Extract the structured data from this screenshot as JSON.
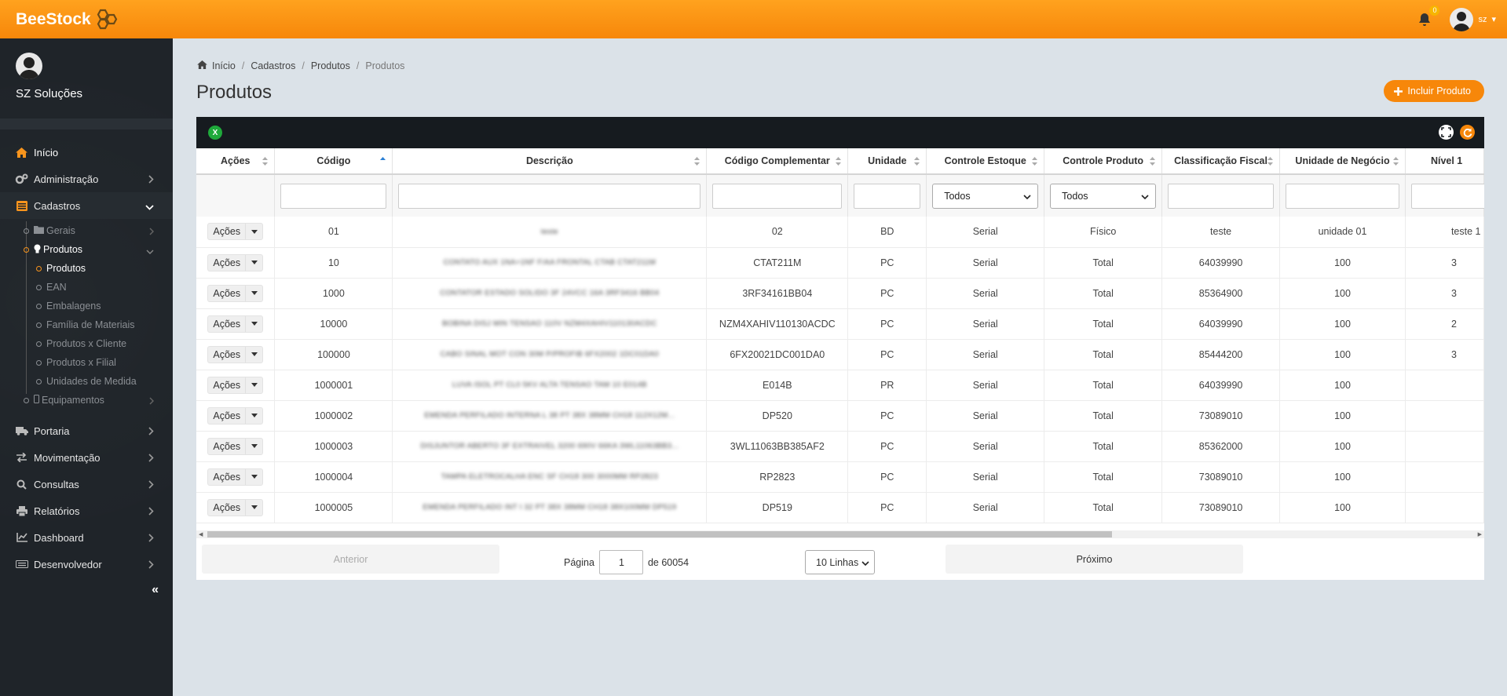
{
  "brand": {
    "name_part1": "Bee",
    "name_part2": "Stock"
  },
  "topbar": {
    "notifications_count": "0",
    "user_initials": "sz"
  },
  "sidebar": {
    "company": "SZ Soluções",
    "menu": [
      {
        "label": "Início",
        "icon": "home-icon"
      },
      {
        "label": "Administração",
        "icon": "cogs-icon"
      },
      {
        "label": "Cadastros",
        "icon": "list-icon"
      }
    ],
    "cadastros_sub": [
      {
        "label": "Gerais",
        "icon": "folder-icon"
      },
      {
        "label": "Produtos",
        "icon": "lightbulb-icon"
      }
    ],
    "produtos_sub": [
      "Produtos",
      "EAN",
      "Embalagens",
      "Família de Materiais",
      "Produtos x Cliente",
      "Produtos x Filial",
      "Unidades de Medida"
    ],
    "equipamentos": "Equipamentos",
    "menu_bottom": [
      {
        "label": "Portaria",
        "icon": "truck-icon"
      },
      {
        "label": "Movimentação",
        "icon": "exchange-icon"
      },
      {
        "label": "Consultas",
        "icon": "search-icon"
      },
      {
        "label": "Relatórios",
        "icon": "print-icon"
      },
      {
        "label": "Dashboard",
        "icon": "chart-icon"
      },
      {
        "label": "Desenvolvedor",
        "icon": "keyboard-icon"
      }
    ],
    "collapse_glyph": "«"
  },
  "breadcrumb": [
    "Início",
    "Cadastros",
    "Produtos",
    "Produtos"
  ],
  "page_title": "Produtos",
  "add_button": "Incluir Produto",
  "table": {
    "columns": [
      "Ações",
      "Código",
      "Descrição",
      "Código Complementar",
      "Unidade",
      "Controle Estoque",
      "Controle Produto",
      "Classificação Fiscal",
      "Unidade de Negócio",
      "Nível 1"
    ],
    "filter_select_value": "Todos",
    "action_label": "Ações",
    "rows": [
      {
        "codigo": "01",
        "descricao": "teste",
        "comp": "02",
        "unidade": "BD",
        "estoque": "Serial",
        "produto": "Físico",
        "fiscal": "teste",
        "negocio": "unidade 01",
        "nivel": "teste 1"
      },
      {
        "codigo": "10",
        "descricao": "CONTATO AUX 1NA+1NF F/AA FRONTAL CTAB CTAT211M",
        "comp": "CTAT211M",
        "unidade": "PC",
        "estoque": "Serial",
        "produto": "Total",
        "fiscal": "64039990",
        "negocio": "100",
        "nivel": "3"
      },
      {
        "codigo": "1000",
        "descricao": "CONTATOR ESTADO SOLIDO 3F 24VCC 16A 3RF3416 BB04",
        "comp": "3RF34161BB04",
        "unidade": "PC",
        "estoque": "Serial",
        "produto": "Total",
        "fiscal": "85364900",
        "negocio": "100",
        "nivel": "3"
      },
      {
        "codigo": "10000",
        "descricao": "BOBINA DISJ MIN TENSAO 110V NZM4XAHIV110130ACDC",
        "comp": "NZM4XAHIV110130ACDC",
        "unidade": "PC",
        "estoque": "Serial",
        "produto": "Total",
        "fiscal": "64039990",
        "negocio": "100",
        "nivel": "2"
      },
      {
        "codigo": "100000",
        "descricao": "CABO SINAL MOT CON 30M P/PROFIB 6FX2002 1DC01DA0",
        "comp": "6FX20021DC001DA0",
        "unidade": "PC",
        "estoque": "Serial",
        "produto": "Total",
        "fiscal": "85444200",
        "negocio": "100",
        "nivel": "3"
      },
      {
        "codigo": "1000001",
        "descricao": "LUVA ISOL PT CL0 5KV ALTA TENSAO TAM 10 E014B",
        "comp": "E014B",
        "unidade": "PR",
        "estoque": "Serial",
        "produto": "Total",
        "fiscal": "64039990",
        "negocio": "100",
        "nivel": ""
      },
      {
        "codigo": "1000002",
        "descricao": "EMENDA PERFILADO INTERNA L 38 PT 38X 38MM CH18 112X12M...",
        "comp": "DP520",
        "unidade": "PC",
        "estoque": "Serial",
        "produto": "Total",
        "fiscal": "73089010",
        "negocio": "100",
        "nivel": ""
      },
      {
        "codigo": "1000003",
        "descricao": "DISJUNTOR ABERTO 3F EXTRAIVEL 3200 690V 66KA 3WL11063BB3...",
        "comp": "3WL11063BB385AF2",
        "unidade": "PC",
        "estoque": "Serial",
        "produto": "Total",
        "fiscal": "85362000",
        "negocio": "100",
        "nivel": ""
      },
      {
        "codigo": "1000004",
        "descricao": "TAMPA ELETROCALHA ENC SF CH18 300 3000MM RP2823",
        "comp": "RP2823",
        "unidade": "PC",
        "estoque": "Serial",
        "produto": "Total",
        "fiscal": "73089010",
        "negocio": "100",
        "nivel": ""
      },
      {
        "codigo": "1000005",
        "descricao": "EMENDA PERFILADO INT I 32 PT 38X 38MM CH18 38X100MM DP519",
        "comp": "DP519",
        "unidade": "PC",
        "estoque": "Serial",
        "produto": "Total",
        "fiscal": "73089010",
        "negocio": "100",
        "nivel": ""
      }
    ]
  },
  "pager": {
    "prev": "Anterior",
    "page_label": "Página",
    "page_value": "1",
    "of_label": "de 60054",
    "rows_option": "10 Linhas",
    "next": "Próximo"
  },
  "colors": {
    "accent": "#f7870a",
    "sidebar_bg": "#1f2429",
    "panel_head": "#161b1f"
  }
}
